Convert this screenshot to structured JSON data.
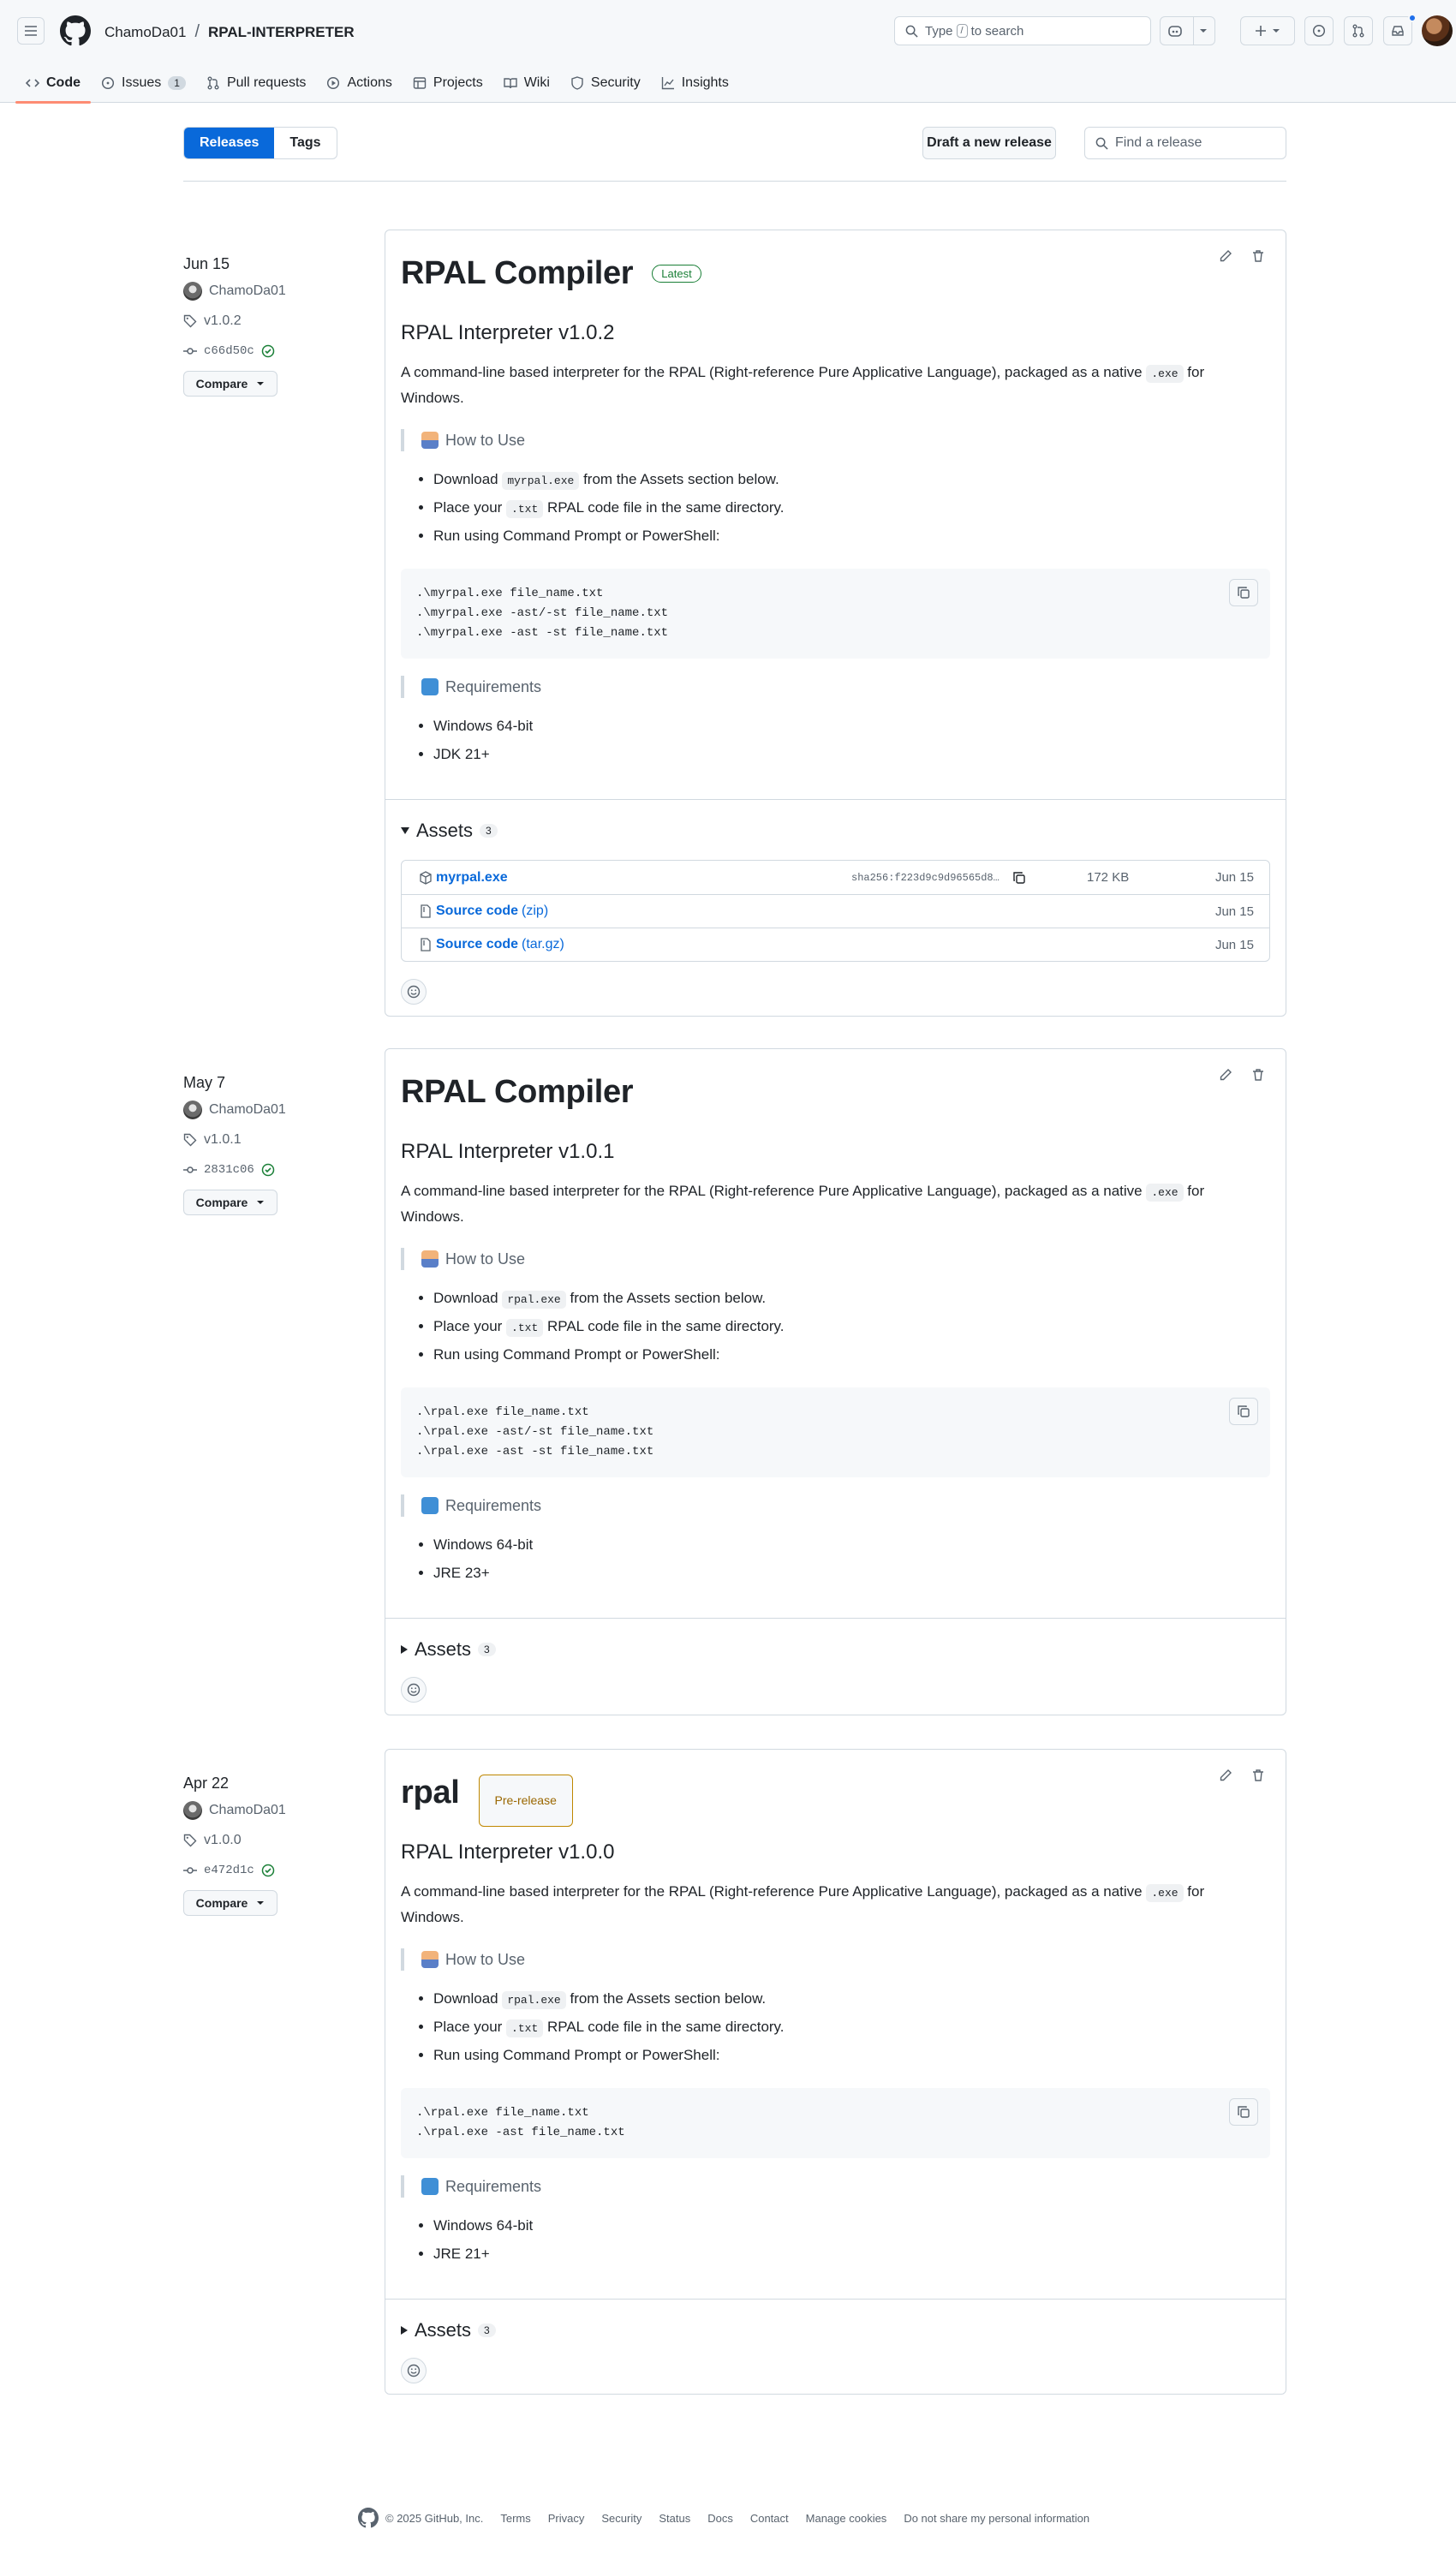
{
  "header": {
    "owner": "ChamoDa01",
    "separator": "/",
    "repo": "RPAL-INTERPRETER",
    "search_prefix": "Type",
    "search_key": "/",
    "search_suffix": "to search"
  },
  "nav": [
    {
      "label": "Code",
      "icon": "code-icon",
      "active": true
    },
    {
      "label": "Issues",
      "icon": "issue-icon",
      "count": "1"
    },
    {
      "label": "Pull requests",
      "icon": "pull-request-icon"
    },
    {
      "label": "Actions",
      "icon": "play-icon"
    },
    {
      "label": "Projects",
      "icon": "table-icon"
    },
    {
      "label": "Wiki",
      "icon": "book-icon"
    },
    {
      "label": "Security",
      "icon": "shield-icon"
    },
    {
      "label": "Insights",
      "icon": "graph-icon"
    }
  ],
  "subnav": {
    "releases": "Releases",
    "tags": "Tags",
    "draft": "Draft a new release",
    "find_placeholder": "Find a release"
  },
  "releases": [
    {
      "date": "Jun 15",
      "author": "ChamoDa01",
      "tag": "v1.0.2",
      "commit": "c66d50c",
      "compare": "Compare",
      "title": "RPAL Compiler",
      "badge": "Latest",
      "subtitle": "RPAL Interpreter v1.0.2",
      "desc_pre": "A command-line based interpreter for the RPAL (Right-reference Pure Applicative Language), packaged as a native ",
      "desc_code": ".exe",
      "desc_post": " for Windows.",
      "howto": "How to Use",
      "step1_pre": "Download ",
      "step1_code": "myrpal.exe",
      "step1_post": " from the Assets section below.",
      "step2_pre": "Place your ",
      "step2_code": ".txt",
      "step2_post": " RPAL code file in the same directory.",
      "step3": "Run using Command Prompt or PowerShell:",
      "code": ".\\myrpal.exe file_name.txt\n.\\myrpal.exe -ast/-st file_name.txt\n.\\myrpal.exe -ast -st file_name.txt",
      "req": "Requirements",
      "req1": "Windows 64-bit",
      "req2": "JDK 21+",
      "assets_label": "Assets",
      "assets_count": "3",
      "assets": [
        {
          "name": "myrpal.exe",
          "sha": "sha256:f223d9c9d96565d8…",
          "size": "172 KB",
          "date": "Jun 15"
        },
        {
          "name": "Source code",
          "ext": "(zip)",
          "date": "Jun 15"
        },
        {
          "name": "Source code",
          "ext": "(tar.gz)",
          "date": "Jun 15"
        }
      ]
    },
    {
      "date": "May 7",
      "author": "ChamoDa01",
      "tag": "v1.0.1",
      "commit": "2831c06",
      "compare": "Compare",
      "title": "RPAL Compiler",
      "subtitle": "RPAL Interpreter v1.0.1",
      "desc_pre": "A command-line based interpreter for the RPAL (Right-reference Pure Applicative Language), packaged as a native ",
      "desc_code": ".exe",
      "desc_post": " for Windows.",
      "howto": "How to Use",
      "step1_pre": "Download ",
      "step1_code": "rpal.exe",
      "step1_post": " from the Assets section below.",
      "step2_pre": "Place your ",
      "step2_code": ".txt",
      "step2_post": " RPAL code file in the same directory.",
      "step3": "Run using Command Prompt or PowerShell:",
      "code": ".\\rpal.exe file_name.txt\n.\\rpal.exe -ast/-st file_name.txt\n.\\rpal.exe -ast -st file_name.txt",
      "req": "Requirements",
      "req1": "Windows 64-bit",
      "req2": "JRE 23+",
      "assets_label": "Assets",
      "assets_count": "3"
    },
    {
      "date": "Apr 22",
      "author": "ChamoDa01",
      "tag": "v1.0.0",
      "commit": "e472d1c",
      "compare": "Compare",
      "title": "rpal",
      "badge": "Pre-release",
      "subtitle": "RPAL Interpreter v1.0.0",
      "desc_pre": "A command-line based interpreter for the RPAL (Right-reference Pure Applicative Language), packaged as a native ",
      "desc_code": ".exe",
      "desc_post": " for Windows.",
      "howto": "How to Use",
      "step1_pre": "Download ",
      "step1_code": "rpal.exe",
      "step1_post": " from the Assets section below.",
      "step2_pre": "Place your ",
      "step2_code": ".txt",
      "step2_post": " RPAL code file in the same directory.",
      "step3": "Run using Command Prompt or PowerShell:",
      "code": ".\\rpal.exe file_name.txt\n.\\rpal.exe -ast file_name.txt",
      "req": "Requirements",
      "req1": "Windows 64-bit",
      "req2": "JRE 21+",
      "assets_label": "Assets",
      "assets_count": "3"
    }
  ],
  "footer": {
    "copyright": "© 2025 GitHub, Inc.",
    "links": [
      "Terms",
      "Privacy",
      "Security",
      "Status",
      "Docs",
      "Contact",
      "Manage cookies",
      "Do not share my personal information"
    ]
  },
  "colors": {
    "accent": "#0969da",
    "latest": "#1a7f37",
    "prerelease": "#9a6700",
    "nav_underline": "#fd8c73"
  }
}
